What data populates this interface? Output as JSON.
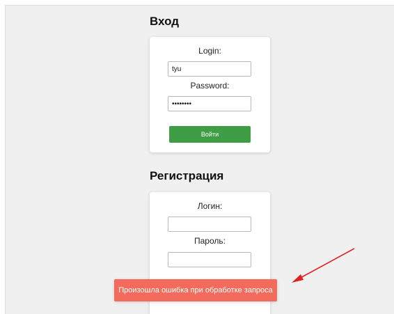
{
  "login_section": {
    "title": "Вход",
    "login_label": "Login:",
    "login_value": "tyu",
    "password_label": "Password:",
    "password_value": "12345678",
    "submit_label": "Войти"
  },
  "register_section": {
    "title": "Регистрация",
    "login_label": "Логин:",
    "login_value": "",
    "password_label": "Пароль:",
    "password_value": ""
  },
  "toast": {
    "message": "Произошла ошибка при обработке запроса",
    "color": "#f36b5c"
  },
  "colors": {
    "accent": "#3f9d45",
    "annotation_arrow": "#e02020"
  }
}
